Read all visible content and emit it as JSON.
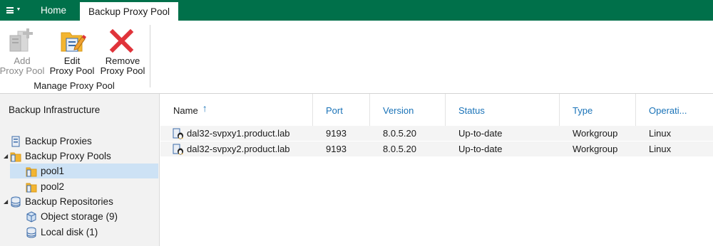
{
  "app": {
    "tabs": [
      {
        "label": "Home"
      },
      {
        "label": "Backup Proxy Pool"
      }
    ]
  },
  "ribbon": {
    "buttons": [
      {
        "line1": "Add",
        "line2": "Proxy Pool",
        "icon": "add-server-icon",
        "enabled": false
      },
      {
        "line1": "Edit",
        "line2": "Proxy Pool",
        "icon": "edit-pencil-icon",
        "enabled": true
      },
      {
        "line1": "Remove",
        "line2": "Proxy Pool",
        "icon": "red-x-icon",
        "enabled": true
      }
    ],
    "group_label": "Manage Proxy Pool"
  },
  "sidebar": {
    "title": "Backup Infrastructure",
    "items": [
      {
        "label": "Backup Proxies",
        "icon": "server-icon",
        "level": 0
      },
      {
        "label": "Backup Proxy Pools",
        "icon": "folder-server-icon",
        "level": 0,
        "expanded": true
      },
      {
        "label": "pool1",
        "icon": "folder-server-icon",
        "level": 1,
        "selected": true
      },
      {
        "label": "pool2",
        "icon": "folder-server-icon",
        "level": 1
      },
      {
        "label": "Backup Repositories",
        "icon": "database-icon",
        "level": 0,
        "expanded": true
      },
      {
        "label": "Object storage (9)",
        "icon": "object-storage-icon",
        "level": 1
      },
      {
        "label": "Local disk (1)",
        "icon": "database-icon",
        "level": 1
      }
    ]
  },
  "table": {
    "columns": [
      "Name",
      "Port",
      "Version",
      "Status",
      "Type",
      "Operati..."
    ],
    "sort_indicator": "↑",
    "rows": [
      {
        "name": "dal32-svpxy1.product.lab",
        "port": "9193",
        "version": "8.0.5.20",
        "status": "Up-to-date",
        "type": "Workgroup",
        "os": "Linux"
      },
      {
        "name": "dal32-svpxy2.product.lab",
        "port": "9193",
        "version": "8.0.5.20",
        "status": "Up-to-date",
        "type": "Workgroup",
        "os": "Linux"
      }
    ]
  },
  "colors": {
    "accent_green": "#00704a",
    "header_blue": "#1a73b8",
    "selection": "#cde2f5",
    "remove_red": "#e0333a"
  }
}
